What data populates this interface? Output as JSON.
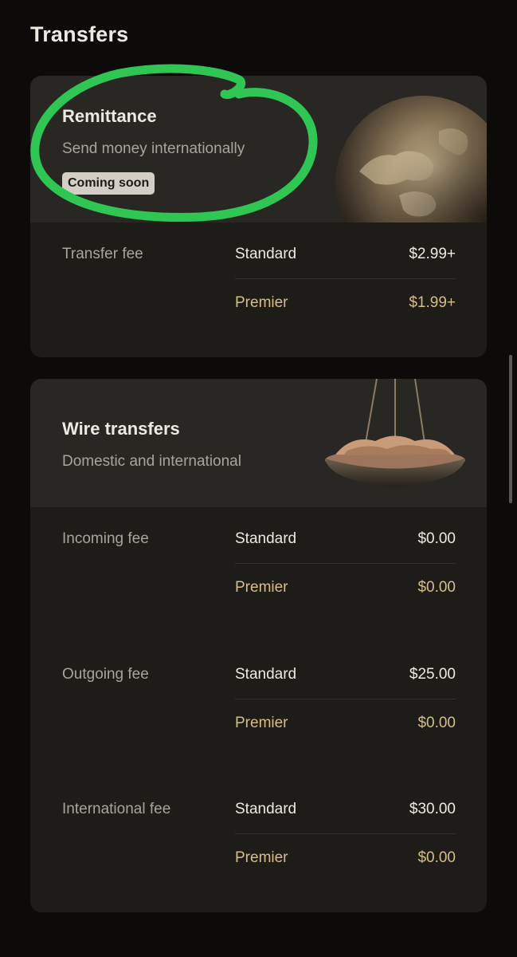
{
  "page": {
    "title": "Transfers"
  },
  "remittance": {
    "title": "Remittance",
    "subtitle": "Send money internationally",
    "badge": "Coming soon",
    "art_icon": "globe-icon",
    "fees": [
      {
        "label": "Transfer fee",
        "standard": {
          "name": "Standard",
          "price": "$2.99+"
        },
        "premier": {
          "name": "Premier",
          "price": "$1.99+"
        }
      }
    ]
  },
  "wire": {
    "title": "Wire transfers",
    "subtitle": "Domestic and international",
    "art_icon": "scale-coins-icon",
    "fees": [
      {
        "label": "Incoming fee",
        "standard": {
          "name": "Standard",
          "price": "$0.00"
        },
        "premier": {
          "name": "Premier",
          "price": "$0.00"
        }
      },
      {
        "label": "Outgoing fee",
        "standard": {
          "name": "Standard",
          "price": "$25.00"
        },
        "premier": {
          "name": "Premier",
          "price": "$0.00"
        }
      },
      {
        "label": "International fee",
        "standard": {
          "name": "Standard",
          "price": "$30.00"
        },
        "premier": {
          "name": "Premier",
          "price": "$0.00"
        }
      }
    ]
  },
  "colors": {
    "background": "#0c0b09",
    "card": "#1d1c19",
    "card_header": "#282724",
    "premier_gold": "#d7be84",
    "annotation_green": "#2fc653"
  }
}
